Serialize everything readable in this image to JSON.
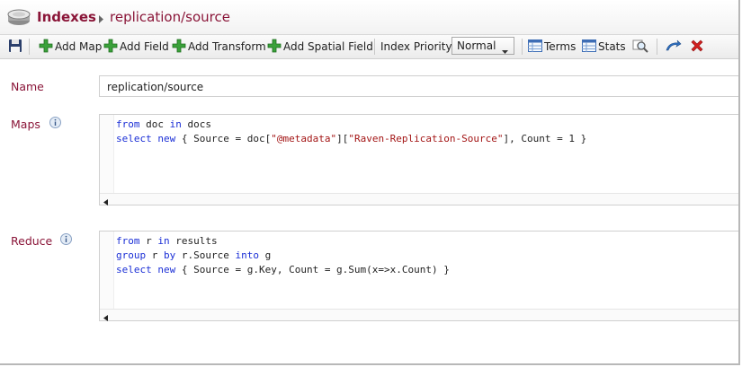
{
  "header": {
    "root": "Indexes",
    "current": "replication/source"
  },
  "toolbar": {
    "save_icon": "save-icon",
    "add_map": "Add Map",
    "add_field": "Add Field",
    "add_transform": "Add Transform",
    "add_spatial_field": "Add Spatial Field",
    "index_priority_label": "Index Priority",
    "index_priority_value": "Normal",
    "terms": "Terms",
    "stats": "Stats"
  },
  "form": {
    "name_label": "Name",
    "name_value": "replication/source",
    "maps_label": "Maps",
    "reduce_label": "Reduce"
  },
  "maps_code": {
    "l1_kw1": "from",
    "l1_t1": " doc ",
    "l1_kw2": "in",
    "l1_t2": " docs",
    "l2_kw1": "select",
    "l2_t1": " ",
    "l2_kw2": "new",
    "l2_t2": " { Source = doc[",
    "l2_s1": "\"@metadata\"",
    "l2_t3": "][",
    "l2_s2": "\"Raven-Replication-Source\"",
    "l2_t4": "], Count = 1 }"
  },
  "reduce_code": {
    "l1_kw1": "from",
    "l1_t1": " r ",
    "l1_kw2": "in",
    "l1_t2": " results",
    "l2_kw1": "group",
    "l2_t1": " r ",
    "l2_kw2": "by",
    "l2_t2": " r.Source ",
    "l2_kw3": "into",
    "l2_t3": " g",
    "l3_kw1": "select",
    "l3_t1": " ",
    "l3_kw2": "new",
    "l3_t2": " { Source = g.Key, Count = g.Sum(x=>x.Count) }"
  },
  "colors": {
    "accent": "#8a1538",
    "keyword": "#1b2fd6",
    "string": "#a31515",
    "add_icon": "#3aa13a",
    "delete_icon": "#d42020"
  }
}
